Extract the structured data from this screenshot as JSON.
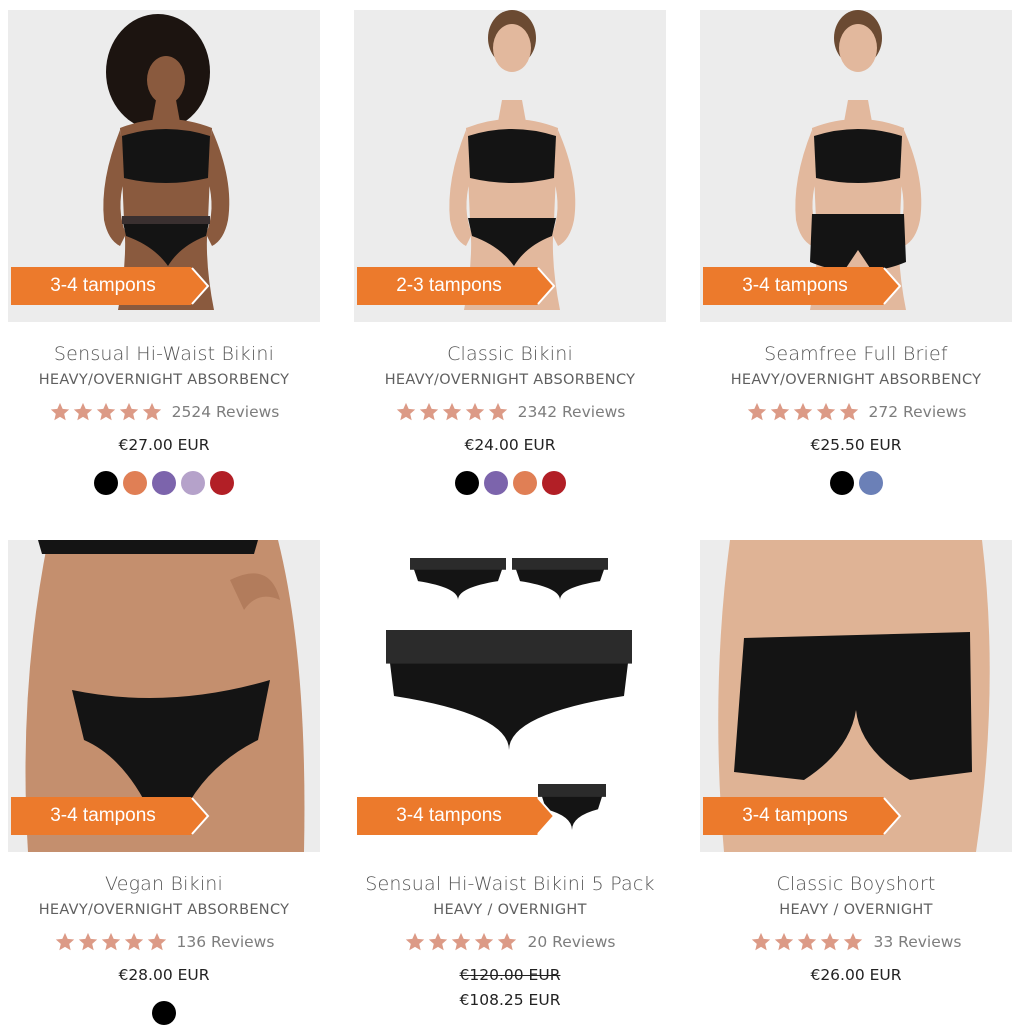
{
  "products": [
    {
      "name": "Sensual Hi-Waist Bikini",
      "absorbency": "HEAVY/OVERNIGHT ABSORBENCY",
      "badge": "3-4 tampons",
      "rating": 5,
      "reviews": "2524 Reviews",
      "price": "€27.00 EUR",
      "swatches": [
        "#000000",
        "#e07f55",
        "#7c64ac",
        "#b5a2ca",
        "#b21f26"
      ],
      "image": {
        "type": "model-lace-bikini",
        "skin": "#8a5a3e"
      }
    },
    {
      "name": "Classic Bikini",
      "absorbency": "HEAVY/OVERNIGHT ABSORBENCY",
      "badge": "2-3 tampons",
      "rating": 5,
      "reviews": "2342 Reviews",
      "price": "€24.00 EUR",
      "swatches": [
        "#000000",
        "#7c64ac",
        "#e07f55",
        "#b21f26"
      ],
      "image": {
        "type": "model-bikini",
        "skin": "#e2b89d"
      }
    },
    {
      "name": "Seamfree Full Brief",
      "absorbency": "HEAVY/OVERNIGHT ABSORBENCY",
      "badge": "3-4 tampons",
      "rating": 5,
      "reviews": "272 Reviews",
      "price": "€25.50 EUR",
      "swatches": [
        "#000000",
        "#6b80b7"
      ],
      "image": {
        "type": "model-full-brief",
        "skin": "#e2b89d"
      }
    },
    {
      "name": "Vegan Bikini",
      "absorbency": "HEAVY/OVERNIGHT ABSORBENCY",
      "badge": "3-4 tampons",
      "rating": 5,
      "reviews": "136 Reviews",
      "price": "€28.00 EUR",
      "swatches": [
        "#000000"
      ],
      "image": {
        "type": "closeup-bikini",
        "skin": "#c48f6e"
      }
    },
    {
      "name": "Sensual Hi-Waist Bikini 5 Pack",
      "absorbency": "HEAVY / OVERNIGHT",
      "badge": "3-4 tampons",
      "rating": 5,
      "reviews": "20 Reviews",
      "old_price": "€120.00 EUR",
      "price": "€108.25 EUR",
      "swatches": [],
      "image": {
        "type": "flatlay-5pack",
        "skin": ""
      }
    },
    {
      "name": "Classic Boyshort",
      "absorbency": "HEAVY / OVERNIGHT",
      "badge": "3-4 tampons",
      "rating": 5,
      "reviews": "33 Reviews",
      "price": "€26.00 EUR",
      "swatches": [],
      "image": {
        "type": "closeup-boyshort",
        "skin": "#dfb395"
      }
    }
  ],
  "colors": {
    "badge": "#ec7a2c",
    "star": "#dc9a86",
    "text": "#555555"
  },
  "icons": {
    "star": "star-icon",
    "badge_arrow": "arrow-banner-icon"
  }
}
